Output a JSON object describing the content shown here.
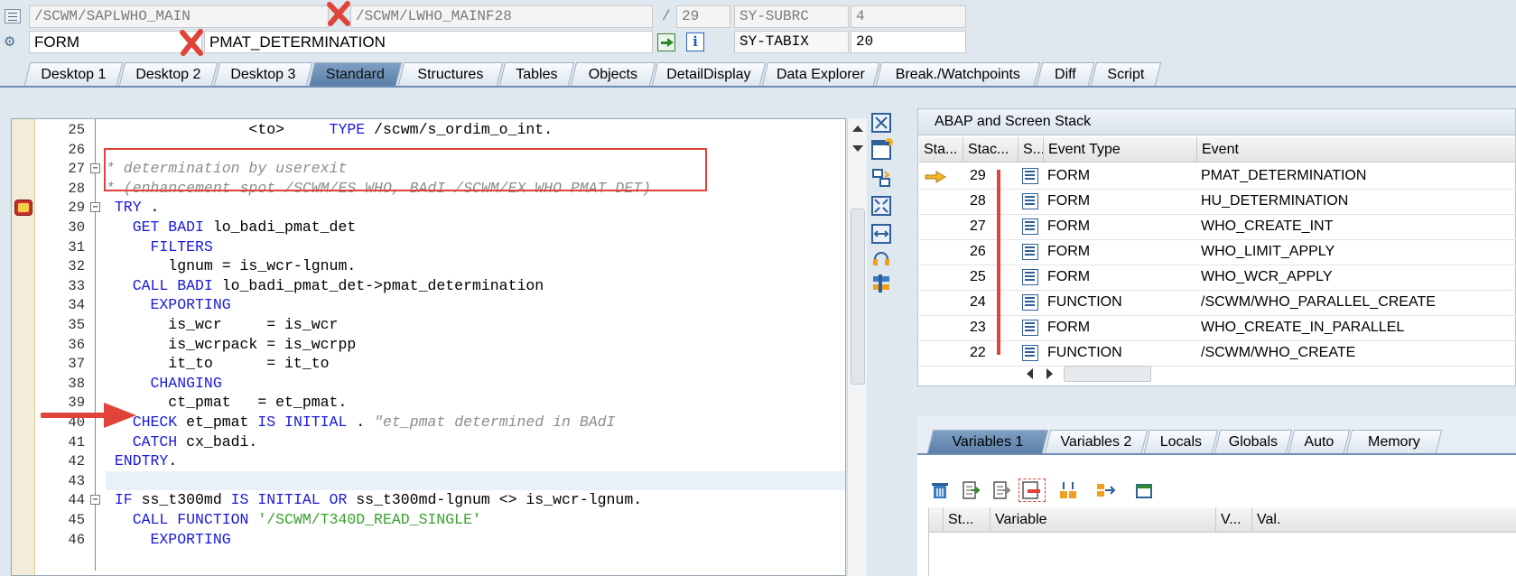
{
  "header": {
    "program": "/SCWM/SAPLWHO_MAIN",
    "include": "/SCWM/LWHO_MAINF28",
    "line_sep": "/",
    "line_no": "29",
    "sy_subrc_label": "SY-SUBRC",
    "sy_subrc_value": "4",
    "event_type": "FORM",
    "event_name": "PMAT_DETERMINATION",
    "sy_tabix_label": "SY-TABIX",
    "sy_tabix_value": "20"
  },
  "tabs": [
    "Desktop 1",
    "Desktop 2",
    "Desktop 3",
    "Standard",
    "Structures",
    "Tables",
    "Objects",
    "DetailDisplay",
    "Data Explorer",
    "Break./Watchpoints",
    "Diff",
    "Script"
  ],
  "active_tab": "Standard",
  "code": {
    "lines": [
      {
        "n": "25",
        "segs": [
          [
            "",
            "                <to>     "
          ],
          [
            "kw",
            "TYPE"
          ],
          [
            "",
            " /scwm/s_ordim_o_int."
          ]
        ]
      },
      {
        "n": "26",
        "segs": []
      },
      {
        "n": "27",
        "segs": [
          [
            "cm",
            "* determination by userexit"
          ]
        ]
      },
      {
        "n": "28",
        "segs": [
          [
            "cm",
            "* (enhancement spot /SCWM/ES WHO, BAdI /SCWM/EX WHO PMAT DET)"
          ]
        ]
      },
      {
        "n": "29",
        "segs": [
          [
            "kw",
            " TRY"
          ],
          [
            "",
            " ."
          ]
        ]
      },
      {
        "n": "30",
        "segs": [
          [
            "kw",
            "   GET BADI"
          ],
          [
            "",
            " lo_badi_pmat_det"
          ]
        ]
      },
      {
        "n": "31",
        "segs": [
          [
            "kw",
            "     FILTERS"
          ]
        ]
      },
      {
        "n": "32",
        "segs": [
          [
            "",
            "       lgnum = is_wcr-lgnum."
          ]
        ]
      },
      {
        "n": "33",
        "segs": [
          [
            "kw",
            "   CALL BADI"
          ],
          [
            "",
            " lo_badi_pmat_det->pmat_determination"
          ]
        ]
      },
      {
        "n": "34",
        "segs": [
          [
            "kw",
            "     EXPORTING"
          ]
        ]
      },
      {
        "n": "35",
        "segs": [
          [
            "",
            "       is_wcr     = is_wcr"
          ]
        ]
      },
      {
        "n": "36",
        "segs": [
          [
            "",
            "       is_wcrpack = is_wcrpp"
          ]
        ]
      },
      {
        "n": "37",
        "segs": [
          [
            "",
            "       it_to      = it_to"
          ]
        ]
      },
      {
        "n": "38",
        "segs": [
          [
            "kw",
            "     CHANGING"
          ]
        ]
      },
      {
        "n": "39",
        "segs": [
          [
            "",
            "       ct_pmat   = et_pmat."
          ]
        ]
      },
      {
        "n": "40",
        "segs": [
          [
            "kw",
            "   CHECK"
          ],
          [
            "",
            " et_pmat "
          ],
          [
            "kw",
            "IS INITIAL"
          ],
          [
            "",
            " . "
          ],
          [
            "cm",
            "\"et_pmat determined in BAdI"
          ]
        ]
      },
      {
        "n": "41",
        "segs": [
          [
            "kw",
            "   CATCH"
          ],
          [
            "",
            " cx_badi."
          ]
        ]
      },
      {
        "n": "42",
        "segs": [
          [
            "kw",
            " ENDTRY"
          ],
          [
            "",
            "."
          ]
        ]
      },
      {
        "n": "43",
        "segs": []
      },
      {
        "n": "44",
        "segs": [
          [
            "kw",
            " IF"
          ],
          [
            "",
            " ss_t300md "
          ],
          [
            "kw",
            "IS INITIAL OR"
          ],
          [
            "",
            " ss_t300md-lgnum <> is_wcr-lgnum."
          ]
        ]
      },
      {
        "n": "45",
        "segs": [
          [
            "kw",
            "   CALL FUNCTION"
          ],
          [
            "st",
            " '/SCWM/T340D_READ_SINGLE'"
          ]
        ]
      },
      {
        "n": "46",
        "segs": [
          [
            "kw",
            "     EXPORTING"
          ]
        ]
      }
    ]
  },
  "stack": {
    "title": "ABAP and Screen Stack",
    "columns": [
      "Sta...",
      "Stac...",
      "S...",
      "Event Type",
      "Event"
    ],
    "rows": [
      {
        "level": "29",
        "type": "FORM",
        "event": "PMAT_DETERMINATION",
        "current": true
      },
      {
        "level": "28",
        "type": "FORM",
        "event": "HU_DETERMINATION",
        "current": false
      },
      {
        "level": "27",
        "type": "FORM",
        "event": "WHO_CREATE_INT",
        "current": false
      },
      {
        "level": "26",
        "type": "FORM",
        "event": "WHO_LIMIT_APPLY",
        "current": false
      },
      {
        "level": "25",
        "type": "FORM",
        "event": "WHO_WCR_APPLY",
        "current": false
      },
      {
        "level": "24",
        "type": "FUNCTION",
        "event": "/SCWM/WHO_PARALLEL_CREATE",
        "current": false
      },
      {
        "level": "23",
        "type": "FORM",
        "event": "WHO_CREATE_IN_PARALLEL",
        "current": false
      },
      {
        "level": "22",
        "type": "FUNCTION",
        "event": "/SCWM/WHO_CREATE",
        "current": false
      }
    ]
  },
  "var_tabs": [
    "Variables 1",
    "Variables 2",
    "Locals",
    "Globals",
    "Auto",
    "Memory"
  ],
  "var_active": "Variables 1",
  "var_columns": [
    "St...",
    "Variable",
    "V...",
    "Val."
  ],
  "colors": {
    "keyword": "#1a1adb",
    "comment": "#8d8d8d",
    "string": "#3aa02f",
    "annotation": "#e04438"
  },
  "icons": [
    "list-icon",
    "settings-icon",
    "navigate-to-source-icon",
    "info-icon",
    "close-pane-icon",
    "new-tool-icon",
    "swap-tool-icon",
    "fullscreen-icon",
    "resize-icon",
    "service-icon",
    "tool-config-icon",
    "scroll-up-icon",
    "scroll-down-icon",
    "breakpoint-icon",
    "stack-pointer-arrow-icon",
    "screen-stack-icon",
    "delete-icon",
    "import-icon",
    "export-icon",
    "remove-icon",
    "split-icon",
    "transfer-icon",
    "options-icon"
  ]
}
